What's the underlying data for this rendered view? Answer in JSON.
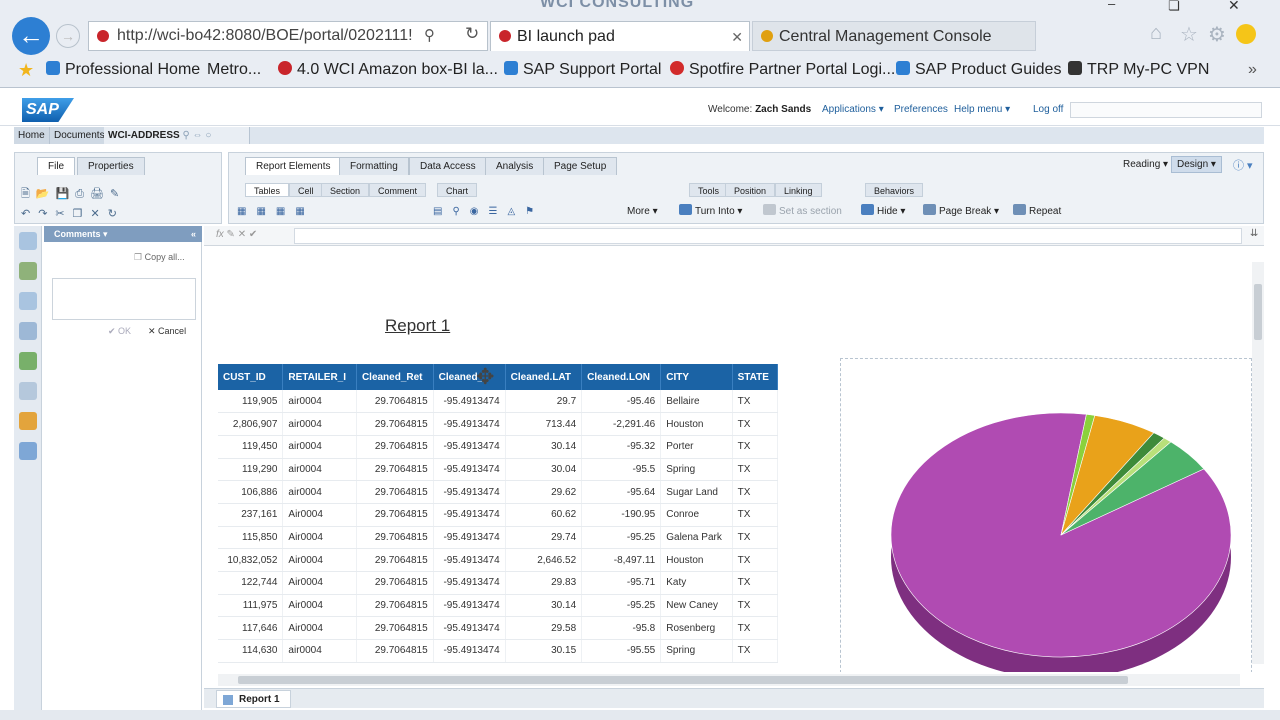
{
  "browser": {
    "address": "http://wci-bo42:8080/BOE/portal/0202111!",
    "brand_text": "WCI CONSULTING",
    "tabs": [
      {
        "label": "BI launch pad",
        "active": true
      },
      {
        "label": "Central Management Console",
        "active": false
      }
    ],
    "favorites": [
      {
        "label": "Professional Home",
        "color": "#f2a23a"
      },
      {
        "label": "Metro...",
        "color": "#ffffff"
      },
      {
        "label": "4.0 WCI Amazon box-BI la...",
        "color": "#c9252b"
      },
      {
        "label": "SAP Support Portal",
        "color": "#2d7fd3"
      },
      {
        "label": "Spotfire Partner Portal Logi...",
        "color": "#d22b2b"
      },
      {
        "label": "SAP Product Guides",
        "color": "#2d7fd3"
      },
      {
        "label": "TRP My-PC VPN",
        "color": "#333333"
      }
    ]
  },
  "header": {
    "welcome_label": "Welcome:",
    "user": "Zach Sands",
    "applications": "Applications ▾",
    "preferences": "Preferences",
    "help": "Help menu ▾",
    "logoff": "Log off"
  },
  "nav": {
    "home": "Home",
    "documents": "Documents",
    "doc": "WCI-ADDRESS"
  },
  "left_panel": {
    "tabs": [
      "File",
      "Properties"
    ]
  },
  "ribbon": {
    "tabs": [
      "Report Elements",
      "Formatting",
      "Data Access",
      "Analysis",
      "Page Setup"
    ],
    "mode_reading": "Reading",
    "mode_design": "Design",
    "subtabs": [
      "Tables",
      "Cell",
      "Section",
      "Comment",
      "Chart",
      "Tools",
      "Position",
      "Linking",
      "Behaviors"
    ],
    "buttons": {
      "more": "More",
      "turn_into": "Turn Into",
      "set_as_section": "Set as section",
      "hide": "Hide",
      "page_break": "Page Break",
      "repeat": "Repeat"
    }
  },
  "comments": {
    "title": "Comments ▾",
    "copy_all": "Copy all...",
    "ok": "OK",
    "cancel": "Cancel"
  },
  "report": {
    "title": "Report 1",
    "tab_label": "Report 1",
    "columns": [
      "CUST_ID",
      "RETAILER_I",
      "Cleaned_Ret",
      "Cleaned_",
      "Cleaned.LAT",
      "Cleaned.LON",
      "CITY",
      "STATE"
    ],
    "rows": [
      [
        "119,905",
        "air0004",
        "29.7064815",
        "-95.4913474",
        "29.7",
        "-95.46",
        "Bellaire",
        "TX"
      ],
      [
        "2,806,907",
        "air0004",
        "29.7064815",
        "-95.4913474",
        "713.44",
        "-2,291.46",
        "Houston",
        "TX"
      ],
      [
        "119,450",
        "air0004",
        "29.7064815",
        "-95.4913474",
        "30.14",
        "-95.32",
        "Porter",
        "TX"
      ],
      [
        "119,290",
        "air0004",
        "29.7064815",
        "-95.4913474",
        "30.04",
        "-95.5",
        "Spring",
        "TX"
      ],
      [
        "106,886",
        "air0004",
        "29.7064815",
        "-95.4913474",
        "29.62",
        "-95.64",
        "Sugar Land",
        "TX"
      ],
      [
        "237,161",
        "Air0004",
        "29.7064815",
        "-95.4913474",
        "60.62",
        "-190.95",
        "Conroe",
        "TX"
      ],
      [
        "115,850",
        "Air0004",
        "29.7064815",
        "-95.4913474",
        "29.74",
        "-95.25",
        "Galena Park",
        "TX"
      ],
      [
        "10,832,052",
        "Air0004",
        "29.7064815",
        "-95.4913474",
        "2,646.52",
        "-8,497.11",
        "Houston",
        "TX"
      ],
      [
        "122,744",
        "Air0004",
        "29.7064815",
        "-95.4913474",
        "29.83",
        "-95.71",
        "Katy",
        "TX"
      ],
      [
        "111,975",
        "Air0004",
        "29.7064815",
        "-95.4913474",
        "30.14",
        "-95.25",
        "New Caney",
        "TX"
      ],
      [
        "117,646",
        "Air0004",
        "29.7064815",
        "-95.4913474",
        "29.58",
        "-95.8",
        "Rosenberg",
        "TX"
      ],
      [
        "114,630",
        "air0004",
        "29.7064815",
        "-95.4913474",
        "30.15",
        "-95.55",
        "Spring",
        "TX"
      ]
    ]
  },
  "pie": {
    "slices": [
      {
        "fraction": 0.865,
        "color": "#b04bb2"
      },
      {
        "fraction": 0.008,
        "color": "#8bd13c"
      },
      {
        "fraction": 0.06,
        "color": "#e9a21a"
      },
      {
        "fraction": 0.012,
        "color": "#3e8b3a"
      },
      {
        "fraction": 0.008,
        "color": "#b8e07a"
      },
      {
        "fraction": 0.047,
        "color": "#4db36a"
      }
    ]
  }
}
